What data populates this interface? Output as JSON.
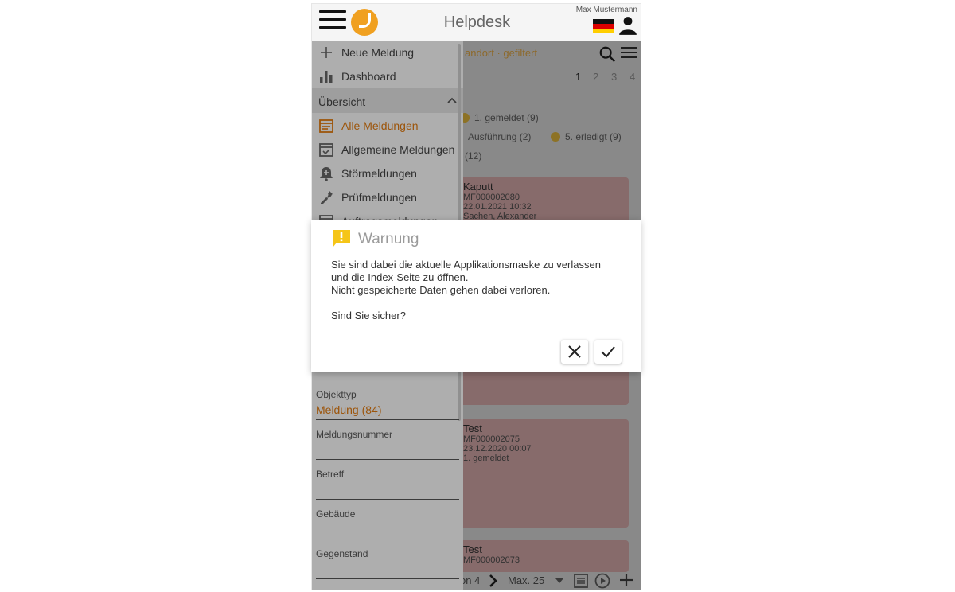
{
  "header": {
    "title": "Helpdesk",
    "user_name": "Max Mustermann"
  },
  "toolbar": {
    "filter_text": "andort · gefiltert"
  },
  "pagination": [
    "1",
    "2",
    "3",
    "4"
  ],
  "statuses": {
    "gemeldet": "1. gemeldet (9)",
    "ausfuehrung": "Ausführung (2)",
    "erledigt": "5. erledigt (9)",
    "count": "(12)"
  },
  "cards": [
    {
      "title": "Kaputt",
      "number": "MF000002080",
      "date": "22.01.2021 10:32",
      "person": "Sachen, Alexander"
    },
    {
      "title": "Test",
      "number": "MF000002075",
      "date": "23.12.2020 00:07",
      "status": "1. gemeldet"
    },
    {
      "title": "Test",
      "number": "MF000002073"
    }
  ],
  "bottom_bar": {
    "page_label": "on 4",
    "max_label": "Max. 25"
  },
  "drawer": {
    "items": [
      {
        "label": "Neue Meldung",
        "icon": "plus-icon"
      },
      {
        "label": "Dashboard",
        "icon": "bar-chart-icon"
      }
    ],
    "section_label": "Übersicht",
    "sub_items": [
      {
        "label": "Alle Meldungen",
        "icon": "calendar-list-icon",
        "active": true
      },
      {
        "label": "Allgemeine Meldungen",
        "icon": "calendar-check-icon"
      },
      {
        "label": "Störmeldungen",
        "icon": "alarm-bell-icon"
      },
      {
        "label": "Prüfmeldungen",
        "icon": "wrench-icon"
      },
      {
        "label": "Auftragsmeldungen",
        "icon": "calendar-icon"
      }
    ],
    "fields": [
      {
        "label": "Objekttyp",
        "value": "Meldung (84)"
      },
      {
        "label": "Meldungsnummer",
        "value": ""
      },
      {
        "label": "Betreff",
        "value": ""
      },
      {
        "label": "Gebäude",
        "value": ""
      },
      {
        "label": "Gegenstand",
        "value": ""
      }
    ]
  },
  "dialog": {
    "title": "Warnung",
    "line1": "Sie sind dabei die aktuelle Applikationsmaske zu verlassen",
    "line2": "und die Index-Seite zu öffnen.",
    "line3": "Nicht gespeicherte Daten gehen dabei verloren.",
    "question": "Sind Sie sicher?"
  },
  "colors": {
    "accent": "#e07a10",
    "warning": "#f5c518",
    "status_dot": "#f3c441",
    "card": "#e8b8b8"
  }
}
